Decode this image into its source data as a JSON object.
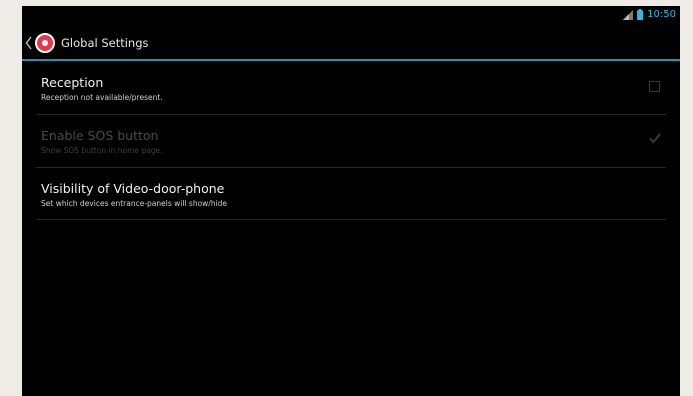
{
  "status_bar": {
    "time": "10:50",
    "icons": [
      "signal-icon",
      "battery-icon"
    ]
  },
  "action_bar": {
    "title": "Global Settings"
  },
  "preferences": [
    {
      "title": "Reception",
      "summary": "Reception not available/present.",
      "checked": false,
      "enabled": true
    },
    {
      "title": "Enable SOS button",
      "summary": "Show SOS button in home page.",
      "checked": true,
      "enabled": false
    },
    {
      "title": "Visibility of Video-door-phone",
      "summary": "Set which devices entrance-panels will show/hide",
      "enabled": true
    }
  ],
  "colors": {
    "accent": "#2f8fa8",
    "status_icon": "#33b5e5",
    "app_icon": "#e8374b",
    "background": "#000000"
  }
}
